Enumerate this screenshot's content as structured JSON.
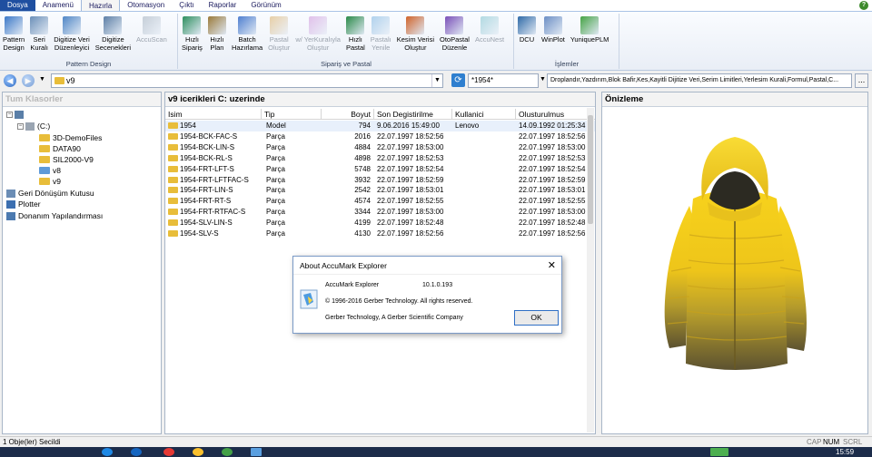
{
  "menu": {
    "tabs": [
      "Dosya",
      "Anamenü",
      "Hazırla",
      "Otomasyon",
      "Çıktı",
      "Raporlar",
      "Görünüm"
    ],
    "active_index": 2
  },
  "ribbon": {
    "groups": [
      {
        "title": "Pattern Design",
        "buttons": [
          {
            "label": "Pattern\nDesign",
            "icon": "pattern-design-icon",
            "enabled": true
          },
          {
            "label": "Seri\nKuralı",
            "icon": "grading-rule-icon",
            "enabled": true
          },
          {
            "label": "Digitize Veri\nDüzenleyici",
            "icon": "digitize-editor-icon",
            "enabled": true
          },
          {
            "label": "Digitize\nSecenekleri",
            "icon": "digitize-options-icon",
            "enabled": true
          },
          {
            "label": "AccuScan",
            "icon": "accuscan-icon",
            "enabled": false
          }
        ]
      },
      {
        "title": "Sipariş ve Pastal",
        "buttons": [
          {
            "label": "Hızlı\nSipariş",
            "icon": "quick-order-icon",
            "enabled": true
          },
          {
            "label": "Hızlı\nPlan",
            "icon": "quick-plan-icon",
            "enabled": true
          },
          {
            "label": "Batch\nHazırlama",
            "icon": "batch-icon",
            "enabled": true
          },
          {
            "label": "Pastal\nOluştur",
            "icon": "create-marker-icon",
            "enabled": false
          },
          {
            "label": "w/ YerKuralıyla\nOluştur",
            "icon": "create-with-rule-icon",
            "enabled": false
          },
          {
            "label": "Hızlı\nPastal",
            "icon": "quick-marker-icon",
            "enabled": true
          },
          {
            "label": "Pastalı\nYenile",
            "icon": "refresh-marker-icon",
            "enabled": false
          },
          {
            "label": "Kesim Verisi\nOluştur",
            "icon": "cut-data-icon",
            "enabled": true
          },
          {
            "label": "OtoPastal\nDüzenle",
            "icon": "automarker-icon",
            "enabled": true
          },
          {
            "label": "AccuNest",
            "icon": "accunest-icon",
            "enabled": false
          }
        ]
      },
      {
        "title": "İşlemler",
        "buttons": [
          {
            "label": "DCU",
            "icon": "dcu-icon",
            "enabled": true
          },
          {
            "label": "WinPlot",
            "icon": "winplot-icon",
            "enabled": true
          },
          {
            "label": "YuniquePLM",
            "icon": "yuniqueplm-icon",
            "enabled": true
          }
        ]
      }
    ]
  },
  "address": {
    "path": "v9",
    "filter": "*1954*",
    "options": "Droplandır,Yazdırım,Blok Bafir,Kes,Kayitli Dijitize Veri,Serim Limitleri,Yerlesim Kurali,Formul,Pastal,C..."
  },
  "left_pane": {
    "title": "Tum Klasorler",
    "tree": [
      {
        "label": "",
        "depth": 0,
        "type": "computer",
        "expander": "−"
      },
      {
        "label": "(C:)",
        "depth": 1,
        "type": "drive",
        "expander": "−"
      },
      {
        "label": "3D-DemoFiles",
        "depth": 2,
        "type": "folder"
      },
      {
        "label": "DATA90",
        "depth": 2,
        "type": "folder"
      },
      {
        "label": "SIL2000-V9",
        "depth": 2,
        "type": "folder"
      },
      {
        "label": "v8",
        "depth": 2,
        "type": "folder-blue"
      },
      {
        "label": "v9",
        "depth": 2,
        "type": "folder"
      },
      {
        "label": "Geri Dönüşüm Kutusu",
        "depth": 0,
        "type": "recycle"
      },
      {
        "label": "Plotter",
        "depth": 0,
        "type": "plotter"
      },
      {
        "label": "Donanım Yapılandırması",
        "depth": 0,
        "type": "hardware"
      }
    ]
  },
  "middle_pane": {
    "title": "v9 icerikleri C: uzerinde",
    "columns": [
      "Isim",
      "Tip",
      "Boyut",
      "Son Degistirilme",
      "Kullanici",
      "Olusturulmus"
    ],
    "rows": [
      {
        "name": "1954",
        "type": "Model",
        "size": "794",
        "modified": "9.06.2016 15:49:00",
        "user": "Lenovo",
        "created": "14.09.1992 01:25:34",
        "selected": true
      },
      {
        "name": "1954-BCK-FAC-S",
        "type": "Parça",
        "size": "2016",
        "modified": "22.07.1997 18:52:56",
        "user": "",
        "created": "22.07.1997 18:52:56"
      },
      {
        "name": "1954-BCK-LIN-S",
        "type": "Parça",
        "size": "4884",
        "modified": "22.07.1997 18:53:00",
        "user": "",
        "created": "22.07.1997 18:53:00"
      },
      {
        "name": "1954-BCK-RL-S",
        "type": "Parça",
        "size": "4898",
        "modified": "22.07.1997 18:52:53",
        "user": "",
        "created": "22.07.1997 18:52:53"
      },
      {
        "name": "1954-FRT-LFT-S",
        "type": "Parça",
        "size": "5748",
        "modified": "22.07.1997 18:52:54",
        "user": "",
        "created": "22.07.1997 18:52:54"
      },
      {
        "name": "1954-FRT-LFTFAC-S",
        "type": "Parça",
        "size": "3932",
        "modified": "22.07.1997 18:52:59",
        "user": "",
        "created": "22.07.1997 18:52:59"
      },
      {
        "name": "1954-FRT-LIN-S",
        "type": "Parça",
        "size": "2542",
        "modified": "22.07.1997 18:53:01",
        "user": "",
        "created": "22.07.1997 18:53:01"
      },
      {
        "name": "1954-FRT-RT-S",
        "type": "Parça",
        "size": "4574",
        "modified": "22.07.1997 18:52:55",
        "user": "",
        "created": "22.07.1997 18:52:55"
      },
      {
        "name": "1954-FRT-RTFAC-S",
        "type": "Parça",
        "size": "3344",
        "modified": "22.07.1997 18:53:00",
        "user": "",
        "created": "22.07.1997 18:53:00"
      },
      {
        "name": "1954-SLV-LIN-S",
        "type": "Parça",
        "size": "4199",
        "modified": "22.07.1997 18:52:48",
        "user": "",
        "created": "22.07.1997 18:52:48"
      },
      {
        "name": "1954-SLV-S",
        "type": "Parça",
        "size": "4130",
        "modified": "22.07.1997 18:52:56",
        "user": "",
        "created": "22.07.1997 18:52:56"
      }
    ]
  },
  "right_pane": {
    "title": "Önizleme",
    "image": "yellow-hooded-puffer-jacket"
  },
  "dialog": {
    "title": "About AccuMark Explorer",
    "product": "AccuMark Explorer",
    "version": "10.1.0.193",
    "copyright": "© 1996-2016 Gerber Technology. All rights reserved.",
    "company": "Gerber Technology, A Gerber Scientific Company",
    "ok_label": "OK"
  },
  "status": {
    "text": "1 Obje(ler) Secildi",
    "indicators": [
      "CAP",
      "NUM",
      "SCRL"
    ]
  },
  "taskbar": {
    "time": "15:59"
  }
}
